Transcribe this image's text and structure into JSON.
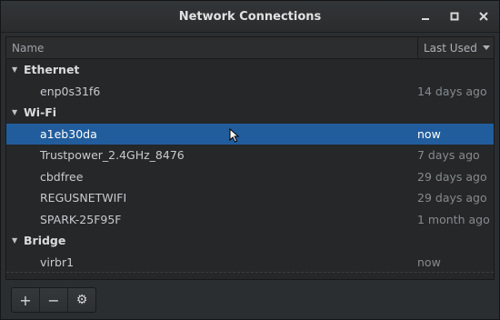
{
  "window": {
    "title": "Network Connections"
  },
  "columns": {
    "name": "Name",
    "last_used": "Last Used"
  },
  "groups": [
    {
      "label": "Ethernet",
      "items": [
        {
          "name": "enp0s31f6",
          "time": "14 days ago"
        }
      ]
    },
    {
      "label": "Wi-Fi",
      "items": [
        {
          "name": "a1eb30da",
          "time": "now"
        },
        {
          "name": "Trustpower_2.4GHz_8476",
          "time": "7 days ago"
        },
        {
          "name": "cbdfree",
          "time": "29 days ago"
        },
        {
          "name": "REGUSNETWIFI",
          "time": "29 days ago"
        },
        {
          "name": "SPARK-25F95F",
          "time": "1 month ago"
        }
      ]
    },
    {
      "label": "Bridge",
      "items": [
        {
          "name": "virbr1",
          "time": "now"
        }
      ]
    }
  ],
  "selected_item": "a1eb30da",
  "toolbar": {
    "add": "+",
    "remove": "−",
    "settings": "⚙"
  },
  "colors": {
    "selection": "#215d9c"
  }
}
